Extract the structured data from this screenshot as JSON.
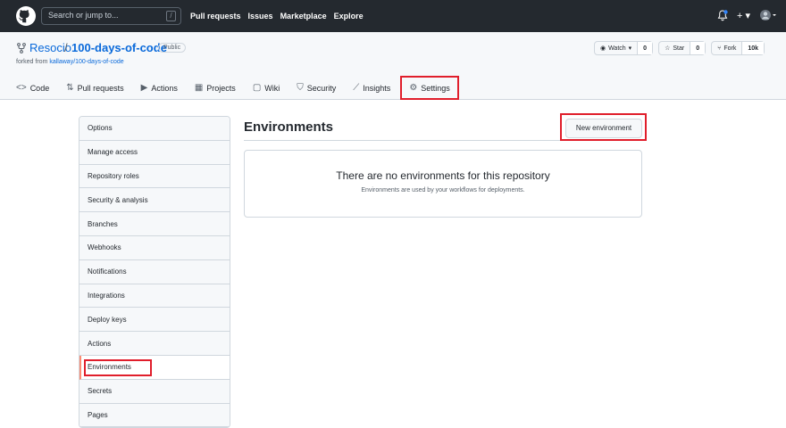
{
  "topbar": {
    "search_placeholder": "Search or jump to...",
    "search_shortcut": "/",
    "nav": [
      "Pull requests",
      "Issues",
      "Marketplace",
      "Explore"
    ]
  },
  "repo": {
    "owner": "Resocio",
    "separator": "/",
    "name": "100-days-of-code",
    "visibility": "Public",
    "forked_prefix": "forked from ",
    "forked_from": "kallaway/100-days-of-code"
  },
  "repo_actions": {
    "watch_label": "Watch",
    "watch_count": "0",
    "star_label": "Star",
    "star_count": "0",
    "fork_label": "Fork",
    "fork_count": "10k"
  },
  "tabs": [
    {
      "label": "Code",
      "icon": "<>"
    },
    {
      "label": "Pull requests",
      "icon": "⇅"
    },
    {
      "label": "Actions",
      "icon": "▶"
    },
    {
      "label": "Projects",
      "icon": "▦"
    },
    {
      "label": "Wiki",
      "icon": "▢"
    },
    {
      "label": "Security",
      "icon": "⛉"
    },
    {
      "label": "Insights",
      "icon": "⟋"
    },
    {
      "label": "Settings",
      "icon": "⚙"
    }
  ],
  "sidebar": {
    "items": [
      "Options",
      "Manage access",
      "Repository roles",
      "Security & analysis",
      "Branches",
      "Webhooks",
      "Notifications",
      "Integrations",
      "Deploy keys",
      "Actions",
      "Environments",
      "Secrets",
      "Pages"
    ],
    "selected": "Environments"
  },
  "main": {
    "title": "Environments",
    "new_button": "New environment",
    "blank_title": "There are no environments for this repository",
    "blank_desc": "Environments are used by your workflows for deployments."
  },
  "colors": {
    "topbar": "#24292f",
    "link": "#0969da",
    "highlight": "#e01e2b"
  }
}
